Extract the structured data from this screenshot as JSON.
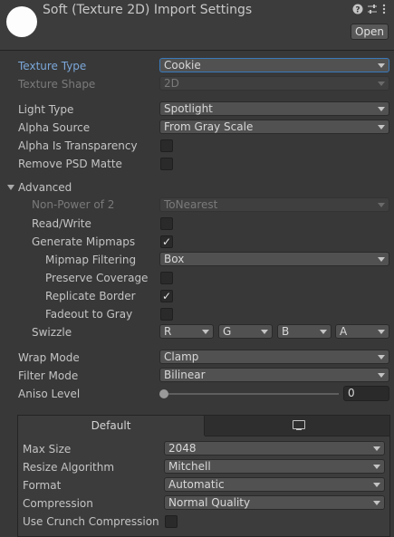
{
  "header": {
    "title": "Soft (Texture 2D) Import Settings",
    "help_icon": "help-icon",
    "settings_icon": "sliders-icon",
    "menu_icon": "kebab-menu-icon",
    "open_label": "Open"
  },
  "fields": {
    "texture_type": {
      "label": "Texture Type",
      "value": "Cookie"
    },
    "texture_shape": {
      "label": "Texture Shape",
      "value": "2D"
    },
    "light_type": {
      "label": "Light Type",
      "value": "Spotlight"
    },
    "alpha_source": {
      "label": "Alpha Source",
      "value": "From Gray Scale"
    },
    "alpha_is_transparency": {
      "label": "Alpha Is Transparency",
      "checked": false
    },
    "remove_psd_matte": {
      "label": "Remove PSD Matte",
      "checked": false
    }
  },
  "advanced": {
    "label": "Advanced",
    "non_power_of_2": {
      "label": "Non-Power of 2",
      "value": "ToNearest"
    },
    "read_write": {
      "label": "Read/Write",
      "checked": false
    },
    "generate_mipmaps": {
      "label": "Generate Mipmaps",
      "checked": true,
      "check_glyph": "✓"
    },
    "mipmap_filtering": {
      "label": "Mipmap Filtering",
      "value": "Box"
    },
    "preserve_coverage": {
      "label": "Preserve Coverage",
      "checked": false
    },
    "replicate_border": {
      "label": "Replicate Border",
      "checked": true,
      "check_glyph": "✓"
    },
    "fadeout_to_gray": {
      "label": "Fadeout to Gray",
      "checked": false
    },
    "swizzle": {
      "label": "Swizzle",
      "r": "R",
      "g": "G",
      "b": "B",
      "a": "A"
    }
  },
  "sampling": {
    "wrap_mode": {
      "label": "Wrap Mode",
      "value": "Clamp"
    },
    "filter_mode": {
      "label": "Filter Mode",
      "value": "Bilinear"
    },
    "aniso_level": {
      "label": "Aniso Level",
      "value": "0",
      "slider_fraction": 0
    }
  },
  "platform": {
    "tabs": [
      {
        "label": "Default",
        "active": true
      },
      {
        "icon": "monitor-icon",
        "active": false
      }
    ],
    "max_size": {
      "label": "Max Size",
      "value": "2048"
    },
    "resize_algorithm": {
      "label": "Resize Algorithm",
      "value": "Mitchell"
    },
    "format": {
      "label": "Format",
      "value": "Automatic"
    },
    "compression": {
      "label": "Compression",
      "value": "Normal Quality"
    },
    "use_crunch_compression": {
      "label": "Use Crunch Compression",
      "checked": false
    }
  },
  "colors": {
    "background": "#383838",
    "focus_label": "#7ba7d9",
    "focus_border": "#3a79bb"
  }
}
